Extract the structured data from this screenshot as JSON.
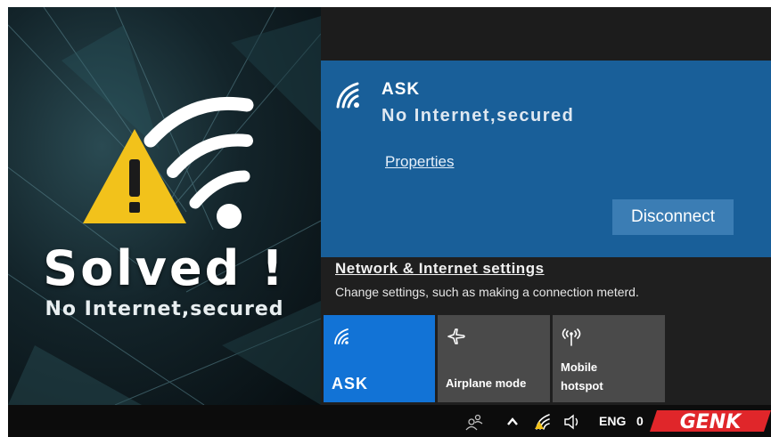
{
  "promo": {
    "headline": "Solved !",
    "subtitle": "No Internet,secured"
  },
  "network": {
    "name": "ASK",
    "status": "No Internet,secured",
    "properties_label": "Properties",
    "disconnect_label": "Disconnect"
  },
  "settings": {
    "link_label": "Network & Internet settings",
    "description": "Change settings, such as making a connection meterd."
  },
  "quick_actions": [
    {
      "label": "ASK",
      "icon": "wifi-icon",
      "active": true
    },
    {
      "label": "Airplane mode",
      "icon": "airplane-icon",
      "active": false
    },
    {
      "label_line1": "Mobile",
      "label_line2": "hotspot",
      "icon": "hotspot-icon",
      "active": false
    }
  ],
  "taskbar": {
    "language": "ENG",
    "time_partial": "0",
    "icons": [
      "people-icon",
      "chevron-up-icon",
      "wifi-warning-icon",
      "volume-icon"
    ]
  },
  "watermark": "GENK",
  "colors": {
    "network_card": "#195f99",
    "active_tile": "#1273d6",
    "tile": "#4a4a4a",
    "warning": "#f2c21b",
    "watermark": "#e0262a"
  }
}
